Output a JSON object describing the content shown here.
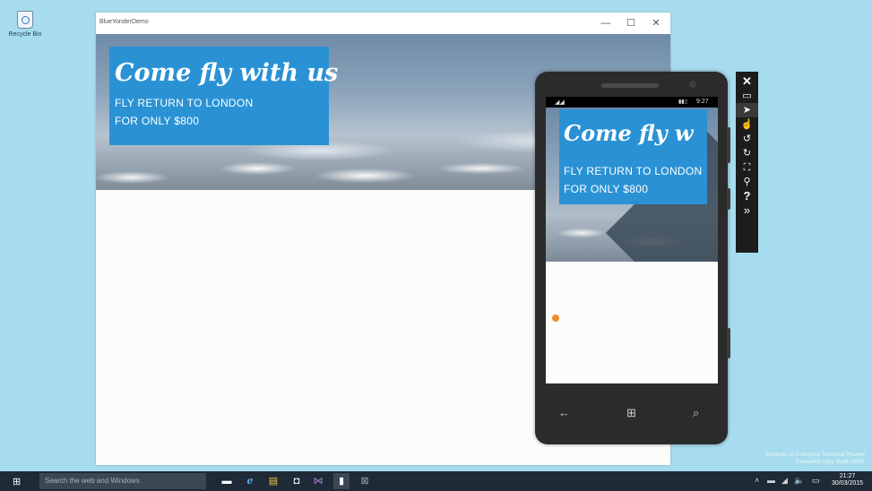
{
  "desktop": {
    "recycle_bin_label": "Recycle Bin"
  },
  "app_window": {
    "title": "BlueYonderDemo",
    "minimize": "—",
    "maximize": "☐",
    "close": "✕",
    "promo": {
      "headline": "Come fly with us",
      "line1": "FLY RETURN TO LONDON",
      "line2": "FOR ONLY $800"
    }
  },
  "phone": {
    "status": {
      "signal": "◢◢",
      "battery": "▮▮▯",
      "time": "9:27"
    },
    "promo": {
      "headline": "Come fly w",
      "line1": "FLY RETURN TO LONDON",
      "line2": "FOR ONLY $800"
    },
    "nav": {
      "back": "←",
      "start": "⊞",
      "search": "⌕"
    }
  },
  "emulator_toolbar": {
    "close": "✕",
    "minimize": "▭",
    "pointer": "➤",
    "touch": "☝",
    "rotate_left": "↺",
    "rotate_right": "↻",
    "fit_screen": "⛶",
    "zoom": "⚲",
    "help": "?",
    "more": "»"
  },
  "watermark": {
    "line1": "Windows 10 Enterprise Technical Preview",
    "line2": "Evaluation copy. Build 10041"
  },
  "taskbar": {
    "search_placeholder": "Search the web and Windows",
    "apps": {
      "task_view": "▬",
      "ie": "e",
      "explorer": "▤",
      "store": "◘",
      "vs": "⋈",
      "phone": "▮",
      "emulator": "⊠"
    },
    "tray": {
      "chevron": "˄",
      "battery": "▬",
      "network": "◢",
      "volume": "🔈",
      "notifications": "▭"
    },
    "clock_time": "21:27",
    "clock_date": "30/03/2015"
  }
}
